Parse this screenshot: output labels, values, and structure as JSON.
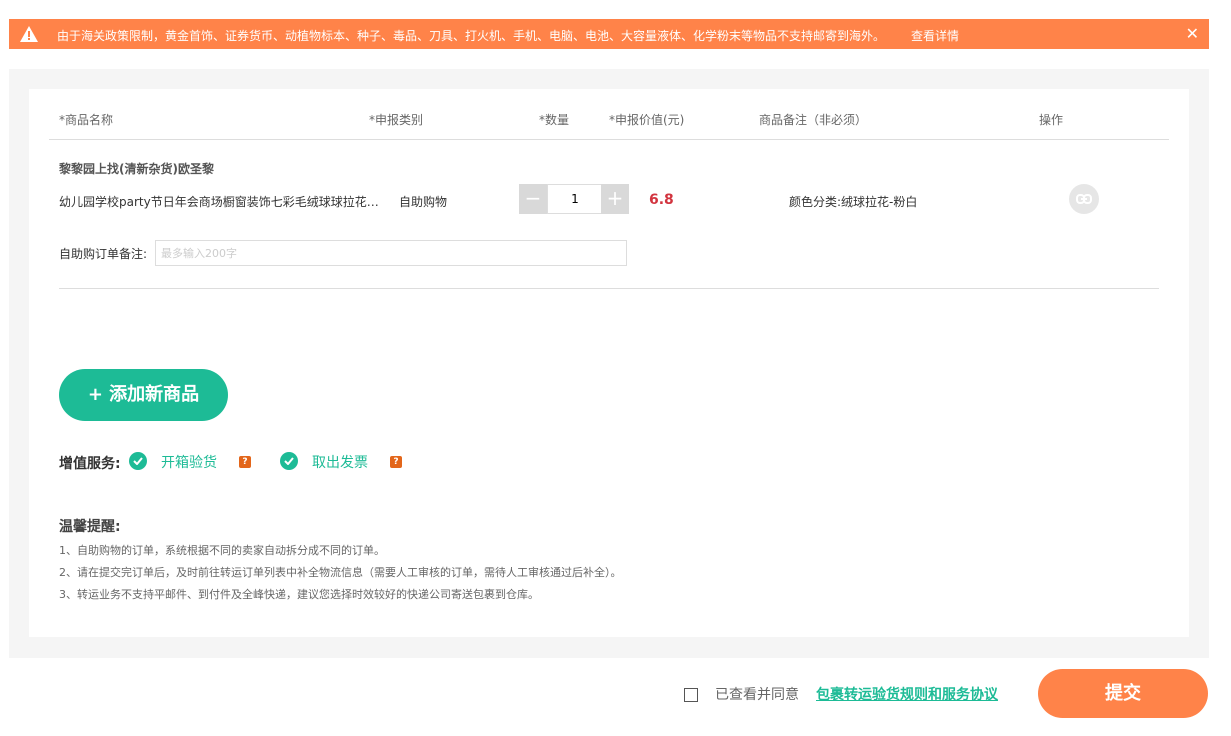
{
  "notice": {
    "message": "由于海关政策限制，黄金首饰、证券货币、动植物标本、种子、毒品、刀具、打火机、手机、电脑、电池、大容量液体、化学粉末等物品不支持邮寄到海外。",
    "details_link": "查看详情",
    "close_symbol": "✕"
  },
  "table": {
    "headers": {
      "name": "*商品名称",
      "category": "*申报类别",
      "qty": "*数量",
      "value": "*申报价值(元)",
      "remark": "商品备注（非必须）",
      "op": "操作"
    }
  },
  "shop": {
    "name": "黎黎园上找(清新杂货)欧圣黎"
  },
  "item": {
    "name": "幼儿园学校party节日年会商场橱窗装饰七彩毛绒球球拉花装饰",
    "category": "自助购物",
    "quantity": "1",
    "minus": "−",
    "plus": "+",
    "price": "6.8",
    "remark": "颜色分类:绒球拉花-粉白"
  },
  "order_note": {
    "label": "自助购订单备注:",
    "placeholder": "最多输入200字"
  },
  "add_button": "+ 添加新商品",
  "value_services": {
    "label": "增值服务:",
    "items": [
      {
        "label": "开箱验货"
      },
      {
        "label": "取出发票"
      }
    ],
    "help_symbol": "?"
  },
  "tips": {
    "title": "温馨提醒:",
    "lines": [
      "1、自助购物的订单，系统根据不同的卖家自动拆分成不同的订单。",
      "2、请在提交完订单后，及时前往转运订单列表中补全物流信息（需要人工审核的订单，需待人工审核通过后补全）。",
      "3、转运业务不支持平邮件、到付件及全峰快递，建议您选择时效较好的快递公司寄送包裹到仓库。"
    ]
  },
  "agreement": {
    "text": "已查看并同意",
    "link": "包裹转运验货规则和服务协议"
  },
  "submit": "提交",
  "colors": {
    "accent_orange": "#ff8349",
    "accent_green": "#1dbb96",
    "price_red": "#d2343f"
  }
}
